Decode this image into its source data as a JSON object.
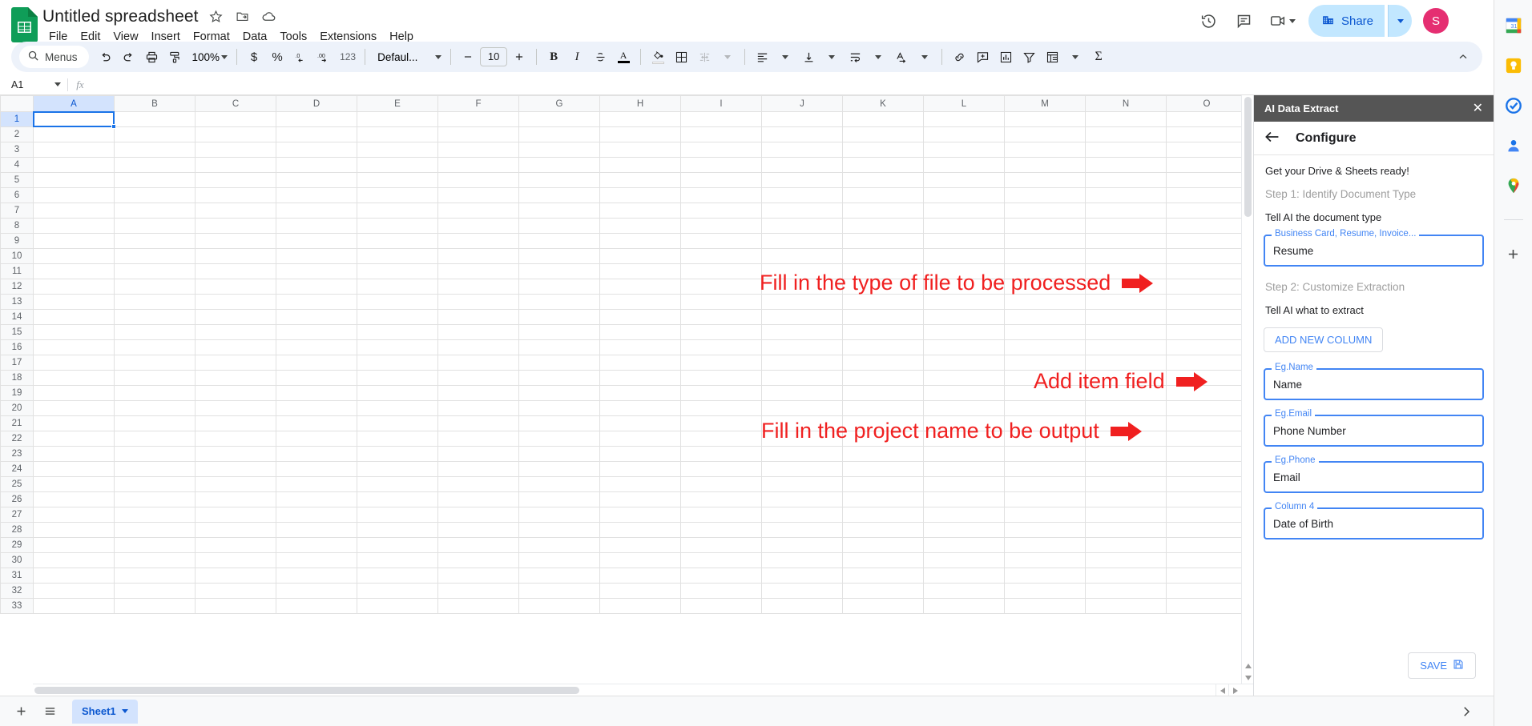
{
  "app": {
    "logo_icon": "google-sheets-icon",
    "doc_title": "Untitled spreadsheet",
    "title_icons": [
      "star-icon",
      "move-to-folder-icon",
      "cloud-saved-icon"
    ],
    "menus": [
      "File",
      "Edit",
      "View",
      "Insert",
      "Format",
      "Data",
      "Tools",
      "Extensions",
      "Help"
    ],
    "header_right": {
      "history_icon": "version-history-icon",
      "comment_icon": "comment-icon",
      "meet_icon": "google-meet-icon",
      "share_label": "Share",
      "share_icon": "share-building-icon",
      "share_caret_icon": "chevron-down-icon",
      "avatar_initial": "S",
      "avatar_color": "#e52e71"
    }
  },
  "toolbar": {
    "menus_label": "Menus",
    "search_icon": "search-icon",
    "undo_icon": "undo-icon",
    "redo_icon": "redo-icon",
    "print_icon": "print-icon",
    "paint_format_icon": "paint-format-icon",
    "zoom_value": "100%",
    "currency_icon": "currency-dollar-icon",
    "percent_icon": "percent-icon",
    "decrease_decimal_icon": "decrease-decimal-icon",
    "increase_decimal_icon": "increase-decimal-icon",
    "more_formats_label": "123",
    "font_family": "Defaul...",
    "font_size": "10",
    "decrease_font_icon": "minus-icon",
    "increase_font_icon": "plus-icon",
    "bold_label": "B",
    "italic_label": "I",
    "strikethrough_icon": "strikethrough-icon",
    "text_color_label": "A",
    "fill_color_icon": "fill-color-icon",
    "borders_icon": "borders-icon",
    "merge_cells_icon": "merge-cells-icon",
    "horizontal_align_icon": "horizontal-align-icon",
    "vertical_align_icon": "vertical-align-icon",
    "text_wrap_icon": "text-wrapping-icon",
    "text_rotation_icon": "text-rotation-icon",
    "insert_link_icon": "insert-link-icon",
    "insert_comment_icon": "insert-comment-icon",
    "insert_chart_icon": "insert-chart-icon",
    "create_filter_icon": "create-filter-icon",
    "functions_icon": "pivot-table-icon",
    "sum_icon": "sum-sigma-icon",
    "collapse_icon": "chevron-up-icon"
  },
  "formula_bar": {
    "name_box": "A1",
    "name_box_caret_icon": "chevron-down-icon",
    "fx_label": "fx",
    "value": ""
  },
  "grid": {
    "columns": [
      "A",
      "B",
      "C",
      "D",
      "E",
      "F",
      "G",
      "H",
      "I",
      "J",
      "K",
      "L",
      "M",
      "N",
      "O"
    ],
    "rows": [
      1,
      2,
      3,
      4,
      5,
      6,
      7,
      8,
      9,
      10,
      11,
      12,
      13,
      14,
      15,
      16,
      17,
      18,
      19,
      20,
      21,
      22,
      23,
      24,
      25,
      26,
      27,
      28,
      29,
      30,
      31,
      32,
      33
    ],
    "selected_cell": "A1",
    "selected_column": "A",
    "selected_row": 1
  },
  "annotations": [
    {
      "text": "Fill in the type of file to be processed",
      "arrow_icon": "right-block-arrow-icon",
      "color": "#f02020"
    },
    {
      "text": "Add item field",
      "arrow_icon": "right-block-arrow-icon",
      "color": "#f02020"
    },
    {
      "text": "Fill in the project name to be output",
      "arrow_icon": "right-block-arrow-icon",
      "color": "#f02020"
    }
  ],
  "addon_panel": {
    "header_title": "AI Data Extract",
    "close_icon": "close-icon",
    "back_icon": "back-arrow-icon",
    "screen_title": "Configure",
    "intro": "Get your Drive & Sheets ready!",
    "step1_title": "Step 1: Identify Document Type",
    "step1_prompt": "Tell AI the document type",
    "doc_type_field": {
      "label": "Business Card, Resume, Invoice...",
      "value": "Resume"
    },
    "step2_title": "Step 2: Customize Extraction",
    "step2_prompt": "Tell AI what to extract",
    "add_new_column_label": "ADD NEW COLUMN",
    "column_fields": [
      {
        "label": "Eg.Name",
        "value": "Name"
      },
      {
        "label": "Eg.Email",
        "value": "Phone Number"
      },
      {
        "label": "Eg.Phone",
        "value": "Email"
      },
      {
        "label": "Column 4",
        "value": "Date of Birth"
      }
    ],
    "save_label": "SAVE",
    "save_icon": "save-disk-icon"
  },
  "sheet_bar": {
    "add_sheet_icon": "plus-icon",
    "all_sheets_icon": "hamburger-menu-icon",
    "tab_name": "Sheet1",
    "tab_caret_icon": "chevron-down-icon",
    "explore_icon": "chevron-right-icon"
  },
  "right_rail": {
    "items": [
      {
        "icon": "google-calendar-icon"
      },
      {
        "icon": "google-keep-icon"
      },
      {
        "icon": "google-tasks-icon"
      },
      {
        "icon": "google-contacts-icon"
      },
      {
        "icon": "google-maps-icon"
      }
    ],
    "add_icon": "plus-icon"
  }
}
